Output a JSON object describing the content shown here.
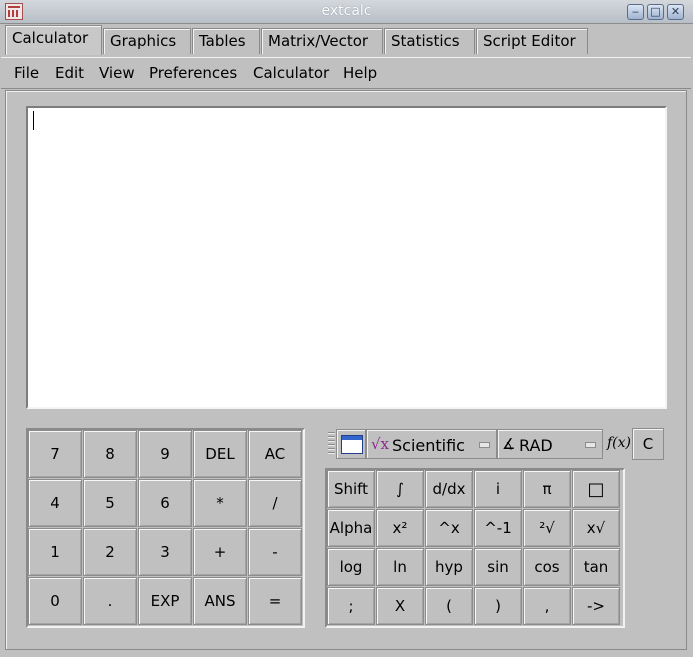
{
  "window": {
    "title": "extcalc",
    "controls": [
      "minimize",
      "maximize",
      "close"
    ]
  },
  "tabs": [
    {
      "label": "Calculator",
      "active": true
    },
    {
      "label": "Graphics",
      "active": false
    },
    {
      "label": "Tables",
      "active": false
    },
    {
      "label": "Matrix/Vector",
      "active": false
    },
    {
      "label": "Statistics",
      "active": false
    },
    {
      "label": "Script Editor",
      "active": false
    }
  ],
  "menu": [
    {
      "label": "File"
    },
    {
      "label": "Edit"
    },
    {
      "label": "View"
    },
    {
      "label": "Preferences"
    },
    {
      "label": "Calculator"
    },
    {
      "label": "Help"
    }
  ],
  "display": {
    "value": ""
  },
  "numpad": [
    [
      "7",
      "8",
      "9",
      "DEL",
      "AC"
    ],
    [
      "4",
      "5",
      "6",
      "*",
      "/"
    ],
    [
      "1",
      "2",
      "3",
      "+",
      "-"
    ],
    [
      "0",
      ".",
      "EXP",
      "ANS",
      "="
    ]
  ],
  "toolbar": {
    "window_icon": "window-icon",
    "mode": {
      "icon": "sqrt-x-icon",
      "icon_glyph": "√x",
      "value": "Scientific"
    },
    "angle": {
      "icon": "angle-icon",
      "icon_glyph": "∡",
      "value": "RAD"
    },
    "fx_label": "f(x)",
    "clear_label": "C"
  },
  "scientific": [
    [
      "Shift",
      "∫",
      "d/dx",
      "i",
      "π",
      "□"
    ],
    [
      "Alpha",
      "x²",
      "^x",
      "^-1",
      "²√",
      "x√"
    ],
    [
      "log",
      "ln",
      "hyp",
      "sin",
      "cos",
      "tan"
    ],
    [
      ";",
      "X",
      "(",
      ")",
      ",",
      "->"
    ]
  ],
  "colors": {
    "background": "#c0c0c0",
    "display_background": "#ffffff",
    "title_text": "#ffffff"
  }
}
